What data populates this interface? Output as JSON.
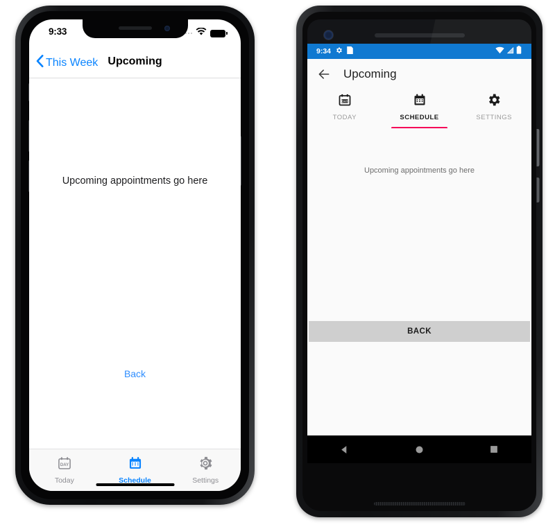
{
  "ios": {
    "status": {
      "time": "9:33",
      "signal_icon": "signal-dots-icon",
      "wifi_icon": "wifi-icon",
      "battery_icon": "battery-icon"
    },
    "navbar": {
      "back_label": "This Week",
      "back_chevron_icon": "chevron-left-icon",
      "title": "Upcoming"
    },
    "content": {
      "placeholder_text": "Upcoming appointments go here",
      "back_button_label": "Back"
    },
    "tabbar": {
      "active_color": "#0a84ff",
      "inactive_color": "#8e8e93",
      "items": [
        {
          "label": "Today",
          "icon": "calendar-day-icon",
          "active": false
        },
        {
          "label": "Schedule",
          "icon": "calendar-icon",
          "active": true
        },
        {
          "label": "Settings",
          "icon": "gear-icon",
          "active": false
        }
      ]
    }
  },
  "android": {
    "status": {
      "time": "9:34",
      "left_icons": [
        "gear-icon",
        "sim-card-icon"
      ],
      "right_icons": [
        "wifi-icon",
        "cell-signal-icon",
        "battery-icon"
      ],
      "background_color": "#1079d1"
    },
    "appbar": {
      "back_icon": "arrow-left-icon",
      "title": "Upcoming"
    },
    "tabs": {
      "indicator_color": "#f50057",
      "items": [
        {
          "label": "TODAY",
          "icon": "calendar-day-icon",
          "active": false
        },
        {
          "label": "SCHEDULE",
          "icon": "calendar-icon",
          "active": true
        },
        {
          "label": "SETTINGS",
          "icon": "gear-icon",
          "active": false
        }
      ]
    },
    "content": {
      "placeholder_text": "Upcoming appointments go here",
      "back_button_label": "BACK"
    },
    "navbar": {
      "back_icon": "nav-back-triangle-icon",
      "home_icon": "nav-home-circle-icon",
      "recents_icon": "nav-recents-square-icon"
    }
  }
}
